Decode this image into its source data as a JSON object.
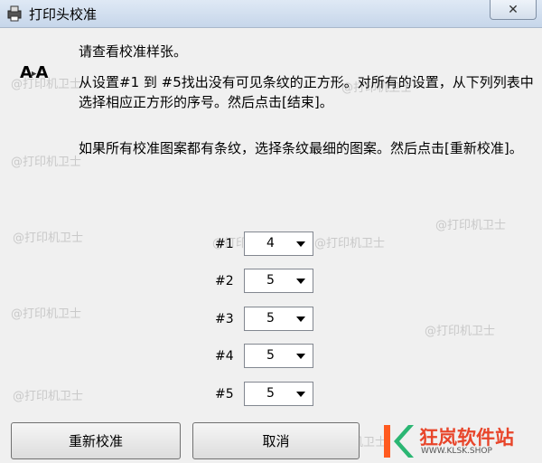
{
  "window": {
    "title": "打印头校准",
    "close_symbol": "✕"
  },
  "instructions": {
    "line1": "请查看校准样张。",
    "line2": "从设置#1 到 #5找出没有可见条纹的正方形。对所有的设置，从下列列表中选择相应正方形的序号。然后点击[结束]。",
    "line3": "如果所有校准图案都有条纹，选择条纹最细的图案。然后点击[重新校准]。"
  },
  "aa_icon": {
    "a1": "A",
    "a2": "A"
  },
  "settings": [
    {
      "label": "#1",
      "value": "4"
    },
    {
      "label": "#2",
      "value": "5"
    },
    {
      "label": "#3",
      "value": "5"
    },
    {
      "label": "#4",
      "value": "5"
    },
    {
      "label": "#5",
      "value": "5"
    }
  ],
  "buttons": {
    "recalibrate": "重新校准",
    "cancel": "取消"
  },
  "watermark": "@打印机卫士",
  "logo": {
    "text": "狂岚软件站",
    "sub": "WWW.KLSK.SHOP",
    "accent": "#e8452a"
  }
}
